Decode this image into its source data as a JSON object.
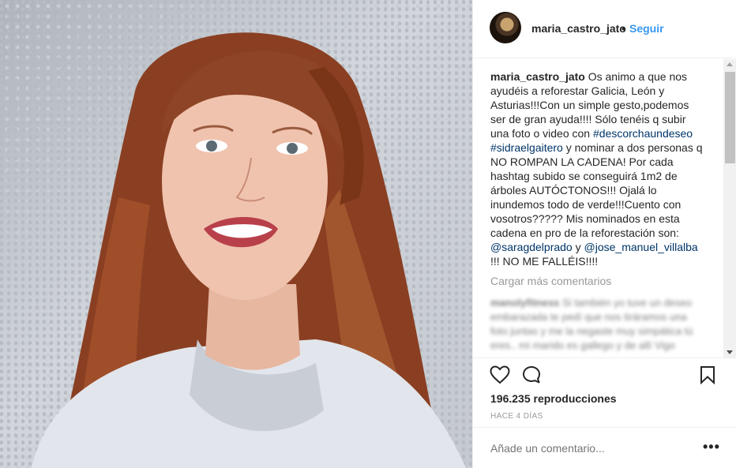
{
  "post": {
    "username": "maria_castro_jato",
    "dot": "•",
    "follow_label": "Seguir",
    "caption_user": "maria_castro_jato",
    "caption_parts": [
      "Os animo a que nos ayudéis a reforestar Galicia, León y Asturias!!!Con un simple gesto,podemos ser de gran ayuda!!!! Sólo tenéis q subir una foto o video con ",
      "#descorchaundeseo",
      " ",
      "#sidraelgaitero",
      " y nominar a dos personas q NO ROMPAN LA CADENA! Por cada hashtag subido se conseguirá 1m2 de árboles AUTÓCTONOS!!! Ojalá lo inundemos todo de verde!!!Cuento con vosotros????? Mis nominados en esta cadena en pro de la reforestación son: ",
      "@saragdelprado",
      " y ",
      "@jose_manuel_villalba",
      " !!! NO ME FALLÉIS!!!!"
    ],
    "load_more_label": "Cargar más comentarios",
    "blurred_comment_user": "manolyfitness",
    "blurred_comment_text": "Si también yo tuve un deseo embarazada te pedí que nos tiráramos una foto juntas y me la negaste muy simpática tú eres.. mi marido es gallego y de allí Vigo",
    "views": "196.235 reproducciones",
    "time_ago": "HACE 4 DÍAS",
    "comment_placeholder": "Añade un comentario...",
    "more_options": "•••"
  },
  "icons": {
    "like": "heart-icon",
    "comment": "comment-bubble-icon",
    "save": "bookmark-icon",
    "options": "more-options-icon"
  },
  "colors": {
    "link_blue": "#3897f0",
    "hashtag": "#003569",
    "muted": "#999999",
    "text": "#262626",
    "border": "#efefef"
  }
}
